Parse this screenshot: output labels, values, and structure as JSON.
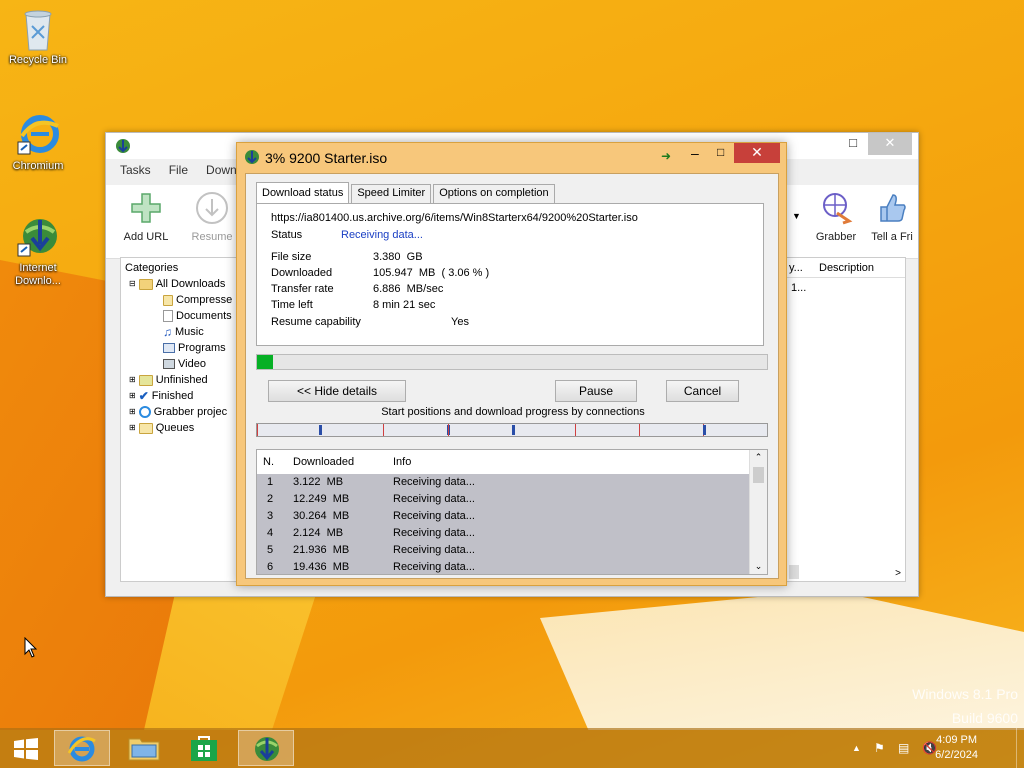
{
  "desktop": {
    "icons": [
      {
        "label": "Recycle Bin"
      },
      {
        "label": "Chromium"
      },
      {
        "label": "Internet Downlo..."
      }
    ],
    "watermark_line1": "Windows 8.1 Pro",
    "watermark_line2": "Build 9600"
  },
  "idm_main": {
    "menu": [
      "Tasks",
      "File",
      "Downlo"
    ],
    "toolbar": {
      "add_url": "Add URL",
      "resume": "Resume",
      "grabber": "Grabber",
      "tell_friend": "Tell a Fri"
    },
    "categories_title": "Categories",
    "categories": [
      {
        "label": "All Downloads"
      },
      {
        "label": "Compresse"
      },
      {
        "label": "Documents"
      },
      {
        "label": "Music"
      },
      {
        "label": "Programs"
      },
      {
        "label": "Video"
      },
      {
        "label": "Unfinished"
      },
      {
        "label": "Finished"
      },
      {
        "label": "Grabber projec"
      },
      {
        "label": "Queues"
      }
    ],
    "list_header_col1": "y...",
    "list_header_col2": "Description",
    "list_cell": "1..."
  },
  "dialog": {
    "title": "3% 9200 Starter.iso",
    "tabs": [
      "Download status",
      "Speed Limiter",
      "Options on completion"
    ],
    "url": "https://ia801400.us.archive.org/6/items/Win8Starterx64/9200%20Starter.iso",
    "status_label": "Status",
    "status_value": "Receiving data...",
    "file_size_label": "File size",
    "file_size_value": "3.380  GB",
    "downloaded_label": "Downloaded",
    "downloaded_value": "105.947  MB  ( 3.06 % )",
    "transfer_rate_label": "Transfer rate",
    "transfer_rate_value": "6.886  MB/sec",
    "time_left_label": "Time left",
    "time_left_value": "8 min 21 sec",
    "resume_label": "Resume capability",
    "resume_value": "Yes",
    "progress_percent": 3.06,
    "hide_details": "<< Hide details",
    "pause": "Pause",
    "cancel": "Cancel",
    "connections_caption": "Start positions and download progress by connections",
    "table_headers": [
      "N.",
      "Downloaded",
      "Info"
    ],
    "connections": [
      {
        "n": "1",
        "downloaded": "3.122  MB",
        "info": "Receiving data..."
      },
      {
        "n": "2",
        "downloaded": "12.249  MB",
        "info": "Receiving data..."
      },
      {
        "n": "3",
        "downloaded": "30.264  MB",
        "info": "Receiving data..."
      },
      {
        "n": "4",
        "downloaded": "2.124  MB",
        "info": "Receiving data..."
      },
      {
        "n": "5",
        "downloaded": "21.936  MB",
        "info": "Receiving data..."
      },
      {
        "n": "6",
        "downloaded": "19.436  MB",
        "info": "Receiving data..."
      }
    ]
  },
  "taskbar": {
    "time": "4:09 PM",
    "date": "6/2/2024"
  },
  "colors": {
    "accent_progress": "#06b025",
    "dialog_frame": "#f7c77b",
    "close_red": "#c7403a",
    "status_blue": "#1a3fc4"
  }
}
